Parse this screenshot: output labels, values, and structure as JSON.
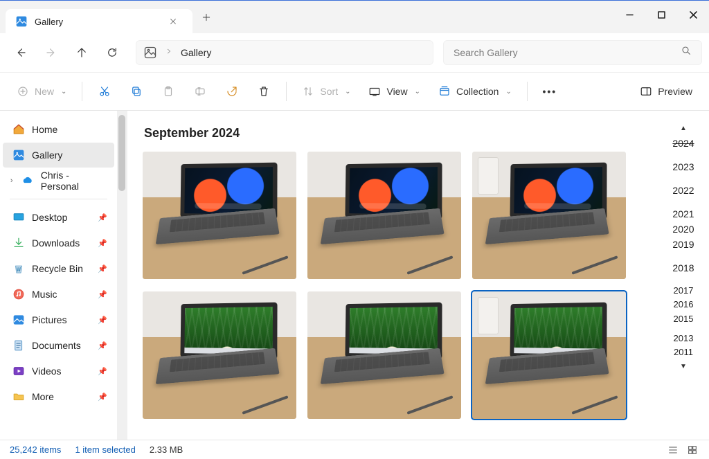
{
  "window": {
    "tab_title": "Gallery"
  },
  "address": {
    "location": "Gallery"
  },
  "search": {
    "placeholder": "Search Gallery"
  },
  "toolbar": {
    "new_label": "New",
    "sort_label": "Sort",
    "view_label": "View",
    "collection_label": "Collection",
    "preview_label": "Preview"
  },
  "sidebar": {
    "home": "Home",
    "gallery": "Gallery",
    "onedrive": "Chris - Personal",
    "items": [
      {
        "label": "Desktop"
      },
      {
        "label": "Downloads"
      },
      {
        "label": "Recycle Bin"
      },
      {
        "label": "Music"
      },
      {
        "label": "Pictures"
      },
      {
        "label": "Documents"
      },
      {
        "label": "Videos"
      },
      {
        "label": "More"
      }
    ]
  },
  "gallery": {
    "section_title": "September 2024"
  },
  "year_rail": {
    "current": "2024",
    "years_top": [
      "2023",
      "2022"
    ],
    "years_mid": [
      "2021",
      "2020",
      "2019"
    ],
    "years_lower": [
      "2018"
    ],
    "years_compact": [
      "2017",
      "2016",
      "2015"
    ],
    "years_bottom": [
      "2013",
      "2011"
    ]
  },
  "status": {
    "count": "25,242 items",
    "selection": "1 item selected",
    "size": "2.33 MB"
  }
}
